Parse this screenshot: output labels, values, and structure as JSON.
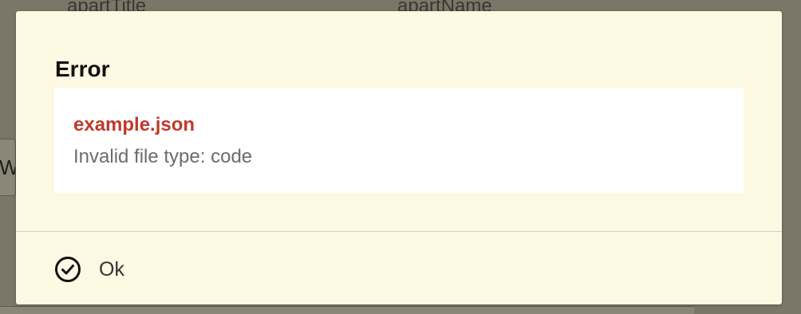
{
  "background": {
    "column_headers": [
      "apartTitle",
      "apartName"
    ],
    "button_text": "Wi"
  },
  "dialog": {
    "title": "Error",
    "error": {
      "file_name": "example.json",
      "message": "Invalid file type: code"
    },
    "ok_button": {
      "label": "Ok",
      "icon": "check-circle-icon"
    }
  },
  "colors": {
    "dialog_background": "#fef9e2",
    "error_file_color": "#c0392b",
    "message_color": "#6b6b6b"
  }
}
